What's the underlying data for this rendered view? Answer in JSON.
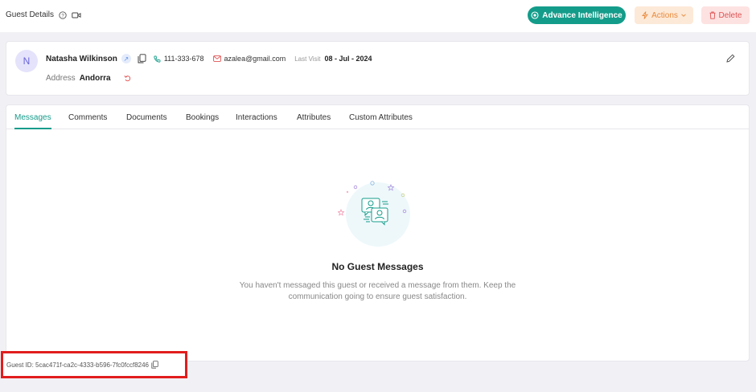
{
  "header": {
    "title": "Guest Details",
    "advance_label": "Advance Intelligence",
    "actions_label": "Actions",
    "delete_label": "Delete"
  },
  "guest": {
    "initial": "N",
    "name": "Natasha Wilkinson",
    "phone": "111-333-678",
    "email": "azalea@gmail.com",
    "last_visit_label": "Last Visit",
    "last_visit": "08 - Jul - 2024",
    "address_label": "Address",
    "address": "Andorra"
  },
  "tabs": [
    {
      "label": "Messages",
      "active": true
    },
    {
      "label": "Comments"
    },
    {
      "label": "Documents"
    },
    {
      "label": "Bookings"
    },
    {
      "label": "Interactions"
    },
    {
      "label": "Attributes"
    },
    {
      "label": "Custom Attributes"
    }
  ],
  "empty_state": {
    "title": "No Guest Messages",
    "line1": "You haven't messaged this guest or received a message from them. Keep the",
    "line2": "communication going to ensure guest satisfaction."
  },
  "footer": {
    "guest_id": "Guest ID: 5cac471f-ca2c-4333-b596-7fc0fccf8246"
  },
  "colors": {
    "brand": "#149c8a",
    "actions_bg": "#fde9d8",
    "delete_bg": "#fde2e2",
    "highlight": "#e21d1d"
  }
}
